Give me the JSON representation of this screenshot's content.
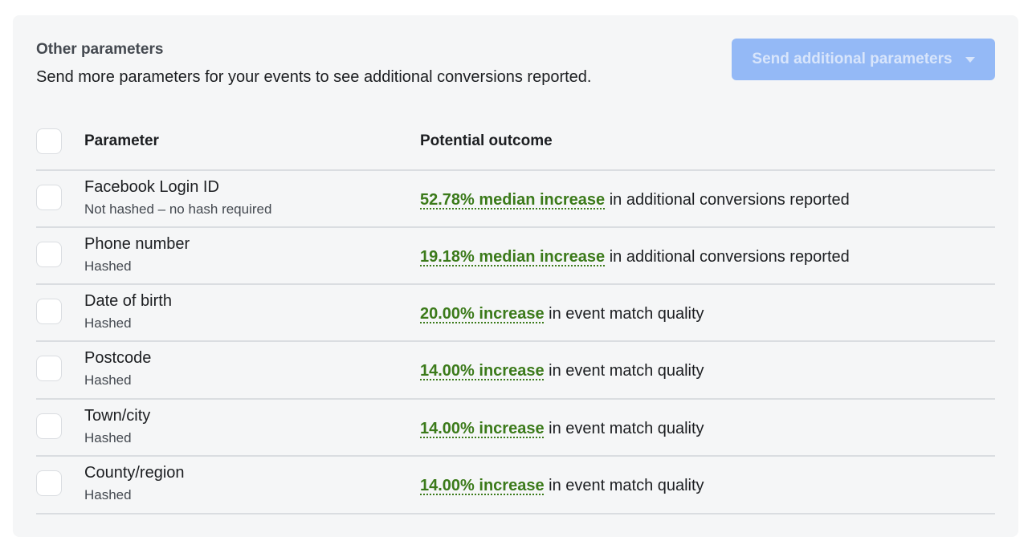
{
  "section": {
    "title": "Other parameters",
    "subtitle": "Send more parameters for your events to see additional conversions reported.",
    "send_button_label": "Send additional parameters",
    "accent_color": "#94b9f6",
    "highlight_color": "#3b7a1a"
  },
  "table": {
    "headers": {
      "parameter": "Parameter",
      "outcome": "Potential outcome"
    },
    "rows": [
      {
        "name": "Facebook Login ID",
        "hash": "Not hashed – no hash required",
        "highlight": "52.78% median increase",
        "rest": " in additional conversions reported",
        "checked": false
      },
      {
        "name": "Phone number",
        "hash": "Hashed",
        "highlight": "19.18% median increase",
        "rest": " in additional conversions reported",
        "checked": false
      },
      {
        "name": "Date of birth",
        "hash": "Hashed",
        "highlight": "20.00% increase",
        "rest": " in event match quality",
        "checked": false
      },
      {
        "name": "Postcode",
        "hash": "Hashed",
        "highlight": "14.00% increase",
        "rest": " in event match quality",
        "checked": false
      },
      {
        "name": "Town/city",
        "hash": "Hashed",
        "highlight": "14.00% increase",
        "rest": " in event match quality",
        "checked": false
      },
      {
        "name": "County/region",
        "hash": "Hashed",
        "highlight": "14.00% increase",
        "rest": " in event match quality",
        "checked": false
      }
    ]
  }
}
